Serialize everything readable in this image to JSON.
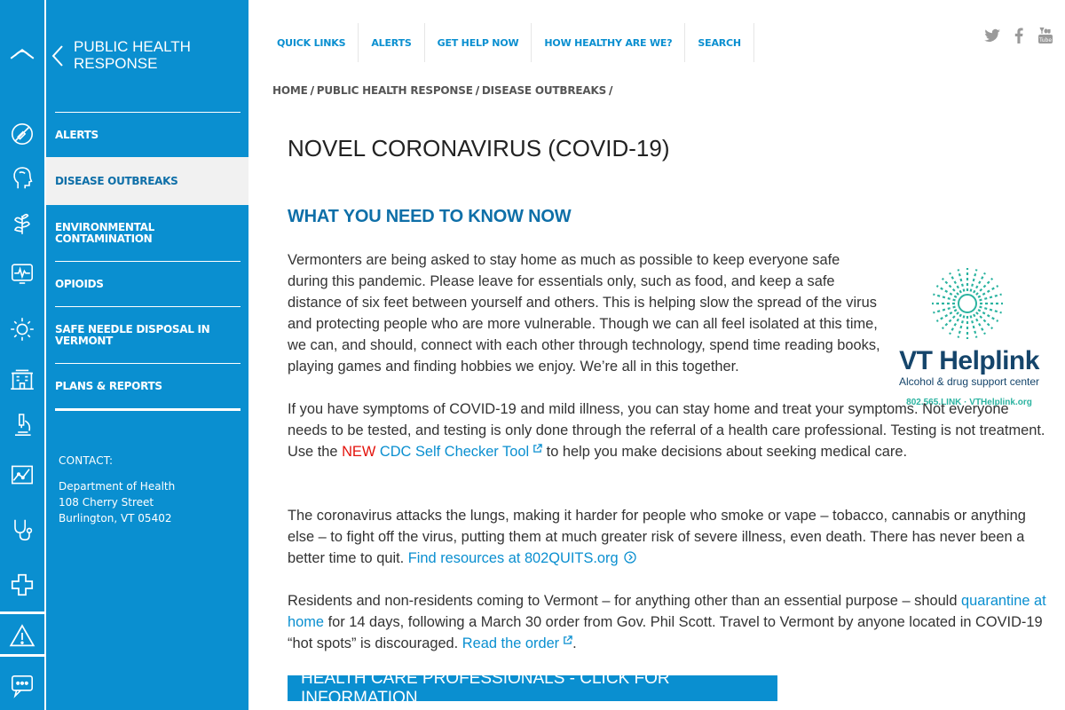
{
  "sidebar": {
    "title": "PUBLIC HEALTH RESPONSE",
    "items": [
      {
        "label": "ALERTS"
      },
      {
        "label": "DISEASE OUTBREAKS"
      },
      {
        "label": "ENVIRONMENTAL CONTAMINATION"
      },
      {
        "label": "OPIOIDS"
      },
      {
        "label": "SAFE NEEDLE DISPOSAL IN VERMONT"
      },
      {
        "label": "PLANS & REPORTS"
      }
    ],
    "contact": {
      "heading": "CONTACT:",
      "lines": [
        "Department of Health",
        "108 Cherry Street",
        "Burlington, VT 05402"
      ]
    }
  },
  "topnav": [
    "QUICK LINKS",
    "ALERTS",
    "GET HELP NOW",
    "HOW HEALTHY ARE WE?",
    "SEARCH"
  ],
  "breadcrumb": [
    "HOME",
    "PUBLIC HEALTH RESPONSE",
    "DISEASE OUTBREAKS"
  ],
  "main": {
    "title": "NOVEL CORONAVIRUS (COVID-19)",
    "section_heading": "WHAT YOU NEED TO KNOW NOW",
    "p1": "Vermonters are being asked to stay home as much as possible to keep everyone safe during this pandemic. Please leave for essentials only, such as food, and keep a safe distance of six feet between yourself and others. This is helping slow the spread of the virus and protecting people who are more vulnerable. Though we can all feel isolated at this time, we can, and should, connect with each other through technology, spend time reading books, playing games and finding hobbies we enjoy. We’re all in this together.",
    "p2_a": "If you have symptoms of COVID-19 and mild illness, you can stay home and treat your symptoms. Not everyone needs to be tested, and testing is only done through the referral of a health care professional. Testing is not treatment. Use the",
    "p2_new": "NEW",
    "p2_link": "CDC Self Checker Tool",
    "p2_b": "to help you make decisions about seeking medical care.",
    "p3_a": "The coronavirus attacks the lungs, making it harder for people who smoke or vape – tobacco, cannabis or anything else – to fight off the virus, putting them at much greater risk of severe illness, even death. There has never been a better time to quit.",
    "p3_link": "Find resources at 802QUITS.org",
    "p4_a": "Residents and non-residents coming to Vermont – for anything other than an essential purpose – should",
    "p4_link1": "quarantine at home",
    "p4_b": "for 14 days, following a March 30 order from Gov. Phil Scott. Travel to Vermont by anyone located in COVID-19 “hot spots” is discouraged.",
    "p4_link2": "Read the order",
    "p4_end": ".",
    "cta": "HEALTH CARE PROFESSIONALS - CLICK FOR INFORMATION"
  },
  "helplink": {
    "name": "VT Helplink",
    "tagline": "Alcohol & drug support center",
    "contact": "802.565.LINK · VTHelplink.org"
  },
  "colors": {
    "primary": "#0a8fd0",
    "heading": "#0e6fa8",
    "new": "#e3120b",
    "helplink_teal": "#2bb3a0",
    "helplink_navy": "#15456b"
  },
  "rail_icons": [
    "home-icon",
    "no-smoking-icon",
    "head-profile-icon",
    "plant-icon",
    "heart-monitor-icon",
    "sun-icon",
    "building-icon",
    "microscope-icon",
    "chart-icon",
    "stethoscope-icon",
    "plus-icon",
    "alert-icon",
    "chat-icon"
  ],
  "social_icons": [
    "twitter-icon",
    "facebook-icon",
    "youtube-icon"
  ]
}
